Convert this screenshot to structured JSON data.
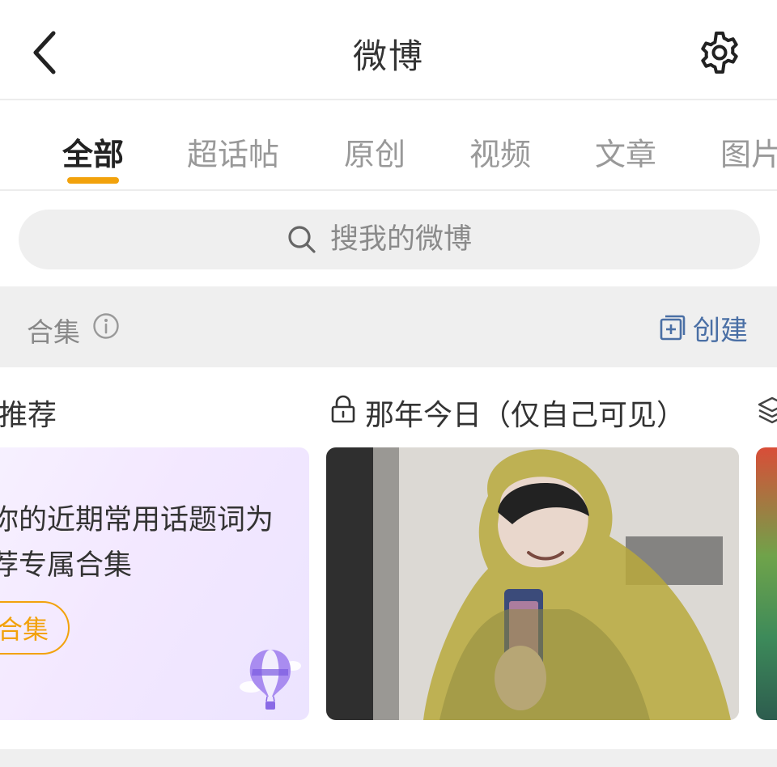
{
  "header": {
    "title": "微博"
  },
  "tabs": [
    {
      "label": "全部",
      "active": true
    },
    {
      "label": "超话帖",
      "active": false
    },
    {
      "label": "原创",
      "active": false
    },
    {
      "label": "视频",
      "active": false
    },
    {
      "label": "文章",
      "active": false
    },
    {
      "label": "图片",
      "active": false
    }
  ],
  "search": {
    "placeholder": "搜我的微博"
  },
  "collection": {
    "label": "合集",
    "create_label": "创建"
  },
  "sections": {
    "recommend_title": "推荐",
    "memories_title": "那年今日（仅自己可见）"
  },
  "recommend_card": {
    "line1": "你的近期常用话题词为",
    "line2": "荐专属合集",
    "button_label": "合集"
  },
  "colors": {
    "accent": "#f2a20c",
    "link_blue": "#4a6fa5"
  }
}
